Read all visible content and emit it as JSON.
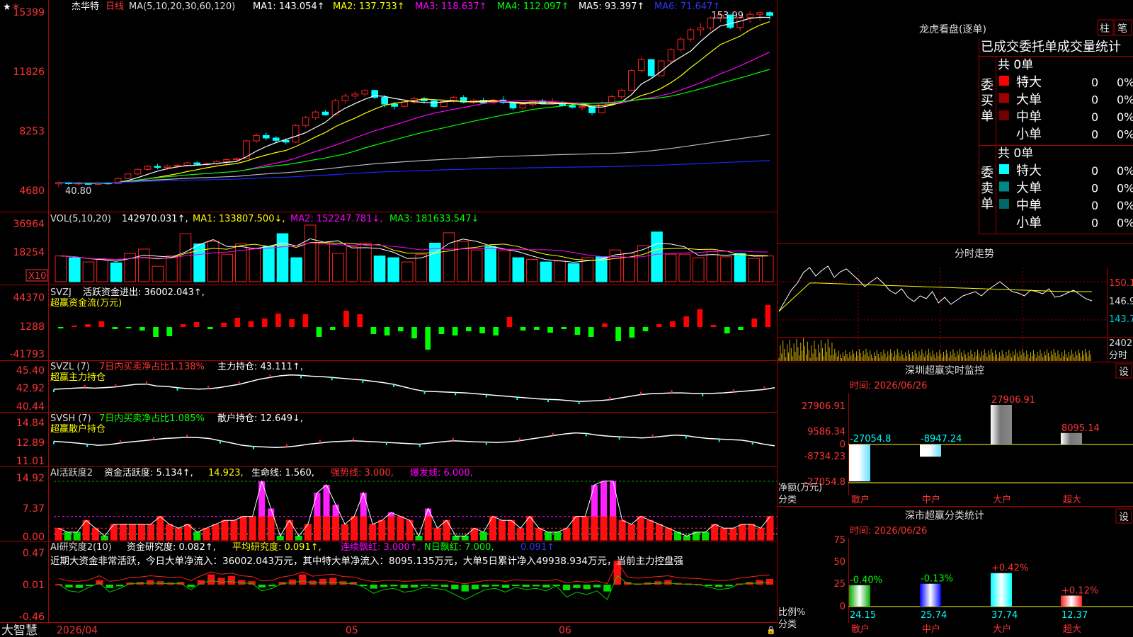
{
  "colors": {
    "up": "#ff2020",
    "down": "#00ffff",
    "grid": "#aa0000",
    "text": "#dddddd",
    "ma1": "#ffffff",
    "ma2": "#ffff00",
    "ma3": "#ff00ff",
    "ma4": "#00ff00",
    "ma5": "#bbbbbb",
    "ma6": "#2222ff",
    "label_white": "#ffffff",
    "label_yellow": "#ffff00",
    "label_magenta": "#ff00ff",
    "label_green": "#00ff00",
    "label_blue": "#3333ff",
    "label_red": "#ff3333"
  },
  "main_chart": {
    "stock_name": "杰华特",
    "period": "日线",
    "ma_header": "MA(5,10,20,30,60,120)",
    "ma1": "MA1: 143.054↑",
    "ma2": "MA2: 137.733↑",
    "ma3": "MA3: 118.637↑",
    "ma4": "MA4: 112.097↑",
    "ma5": "MA5: 93.397↑",
    "ma6": "MA6: 71.647↑",
    "y_ticks": [
      "15399",
      "11826",
      "8253",
      "4680"
    ],
    "high_label": "153.99",
    "low_label": "40.80"
  },
  "vol_panel": {
    "header": "VOL(5,10,20)",
    "value": "142970.031↑,",
    "ma1": "MA1: 133807.500↓,",
    "ma2": "MA2: 152247.781↓,",
    "ma3": "MA3: 181633.547↓",
    "y_ticks": [
      "36964",
      "18254"
    ],
    "unit": "X10"
  },
  "svzj_panel": {
    "name": "SVZJ",
    "label": "活跃资金进出: 36002.043↑,",
    "subtitle": "超赢资金流(万元)",
    "y_ticks": [
      "44370",
      "1288",
      "-41793"
    ]
  },
  "svzl_panel": {
    "name": "SVZL (7)",
    "ratio": "7日内买卖净占比1.138%",
    "hold": "主力持仓: 43.111↑,",
    "subtitle": "超赢主力持仓",
    "y_ticks": [
      "45.40",
      "42.92",
      "40.44"
    ]
  },
  "svsh_panel": {
    "name": "SVSH (7)",
    "ratio": "7日内买卖净占比1.085%",
    "hold": "散户持仓: 12.649↓,",
    "subtitle": "超赢散户持仓",
    "y_ticks": [
      "14.84",
      "12.89",
      "11.01"
    ]
  },
  "ai_active_panel": {
    "name": "AI活跃度2",
    "activity": "资金活跃度: 5.134↑,",
    "v2": "14.923,",
    "life": "生命线: 1.560,",
    "strong": "强势线: 3.000,",
    "burst": "爆发线: 6.000,",
    "y_ticks": [
      "14.92",
      "7.37",
      "0.00"
    ]
  },
  "ai_research_panel": {
    "name": "AI研究度2(10)",
    "research": "资金研究度: 0.082↑,",
    "avg": "平均研究度: 0.091↑,",
    "consec": "连续飘红: 3.000↑,",
    "nday": "N日飘红: 7.000,",
    "v5": "0.091↑",
    "comment": "近期大资金非常活跃，今日大单净流入：36002.043万元，其中特大单净流入：8095.135万元，大单5日累计净入49938.934万元，当前主力控盘强",
    "y_ticks": [
      "0.47",
      "0.01",
      "-0.46"
    ]
  },
  "x_axis": {
    "brand": "大智慧",
    "dates": [
      "2026/04",
      "05",
      "06"
    ]
  },
  "longhu": {
    "title": "龙虎看盘(逐单)",
    "btn_bar": "柱",
    "btn_pen": "笔",
    "tabs": [
      "已成交",
      "委托单",
      "成交量统计"
    ],
    "buy_label": [
      "委",
      "买",
      "单"
    ],
    "sell_label": [
      "委",
      "卖",
      "单"
    ],
    "buy_total": "共 0单",
    "sell_total": "共 0单",
    "buy_rows": [
      {
        "name": "特大",
        "count": "0",
        "pct": "0%",
        "color": "#ff0000"
      },
      {
        "name": "大单",
        "count": "0",
        "pct": "0%",
        "color": "#a00000"
      },
      {
        "name": "中单",
        "count": "0",
        "pct": "0%",
        "color": "#700000"
      },
      {
        "name": "小单",
        "count": "0",
        "pct": "0%",
        "color": ""
      }
    ],
    "sell_rows": [
      {
        "name": "特大",
        "count": "0",
        "pct": "0%",
        "color": "#00ffff"
      },
      {
        "name": "大单",
        "count": "0",
        "pct": "0%",
        "color": "#008888"
      },
      {
        "name": "中单",
        "count": "0",
        "pct": "0%",
        "color": "#006666"
      },
      {
        "name": "小单",
        "count": "0",
        "pct": "0%",
        "color": ""
      }
    ]
  },
  "intraday": {
    "title": "分时走势",
    "y_ticks": [
      "150.1",
      "146.9",
      "143.7"
    ],
    "vol_tick": "2402",
    "vol_label": "分时"
  },
  "sz_monitor": {
    "title": "深圳超赢实时监控",
    "btn": "设",
    "time": "时间: 2026/06/26",
    "y_ticks": [
      "27906.91",
      "9586.34",
      "0",
      "-8734.23",
      "-27054.8"
    ],
    "ylabel": "净额(万元)",
    "xlabel": "分类",
    "categories": [
      "散户",
      "中户",
      "大户",
      "超大"
    ],
    "values": [
      -27054.8,
      -8947.24,
      27906.91,
      8095.14
    ],
    "value_labels": [
      "-27054.8",
      "-8947.24",
      "27906.91",
      "8095.14"
    ]
  },
  "sz_classify": {
    "title": "深市超赢分类统计",
    "btn": "设",
    "time": "时间: 2026/06/26",
    "y_ticks": [
      "75",
      "50",
      "25",
      "0"
    ],
    "ylabel": "比例%",
    "xlabel": "分类",
    "categories": [
      "散户",
      "中户",
      "大户",
      "超大"
    ],
    "values": [
      24.15,
      25.74,
      37.74,
      12.37
    ],
    "value_labels": [
      "24.15",
      "25.74",
      "37.74",
      "12.37"
    ],
    "changes": [
      "-0.40%",
      "-0.13%",
      "+0.42%",
      "+0.12%"
    ]
  },
  "chart_data": {
    "type": "candlestick",
    "ylim": [
      40.8,
      153.99
    ],
    "candles": [
      [
        44.5,
        46.2,
        42.5,
        45.4
      ],
      [
        45.4,
        45.8,
        43.9,
        44.6
      ],
      [
        44.6,
        46.0,
        43.5,
        45.1
      ],
      [
        45.1,
        45.5,
        43.8,
        44.2
      ],
      [
        44.2,
        45.9,
        43.6,
        45.2
      ],
      [
        45.2,
        45.6,
        44.0,
        44.8
      ],
      [
        44.8,
        48.3,
        44.5,
        47.9
      ],
      [
        47.9,
        51.1,
        47.6,
        50.8
      ],
      [
        50.8,
        54.2,
        50.1,
        53.7
      ],
      [
        53.7,
        56.2,
        52.8,
        55.6
      ],
      [
        55.6,
        57.3,
        53.8,
        54.9
      ],
      [
        54.9,
        56.7,
        53.4,
        55.8
      ],
      [
        55.8,
        57.1,
        54.6,
        56.3
      ],
      [
        56.3,
        58.4,
        55.5,
        57.8
      ],
      [
        57.8,
        58.9,
        56.2,
        56.9
      ],
      [
        56.9,
        58.2,
        55.7,
        57.4
      ],
      [
        57.4,
        59.6,
        56.5,
        58.7
      ],
      [
        58.7,
        60.7,
        57.2,
        59.9
      ],
      [
        59.9,
        61.3,
        58.5,
        60.6
      ],
      [
        60.6,
        72.5,
        60.2,
        71.8
      ],
      [
        71.8,
        76.8,
        70.4,
        75.2
      ],
      [
        75.2,
        77.0,
        72.1,
        73.6
      ],
      [
        73.6,
        74.8,
        70.2,
        72.1
      ],
      [
        72.1,
        73.4,
        69.6,
        71.0
      ],
      [
        71.0,
        82.4,
        70.5,
        81.6
      ],
      [
        81.6,
        87.6,
        80.4,
        86.5
      ],
      [
        86.5,
        91.0,
        85.2,
        90.1
      ],
      [
        90.1,
        91.4,
        87.8,
        88.3
      ],
      [
        88.3,
        98.4,
        87.9,
        97.3
      ],
      [
        97.3,
        101.9,
        95.4,
        100.2
      ],
      [
        100.2,
        103.2,
        98.1,
        101.5
      ],
      [
        101.5,
        104.6,
        99.8,
        103.8
      ],
      [
        103.8,
        104.3,
        98.2,
        99.4
      ],
      [
        99.4,
        100.8,
        93.2,
        95.1
      ],
      [
        95.1,
        96.5,
        91.8,
        93.7
      ],
      [
        93.7,
        97.3,
        93.1,
        96.4
      ],
      [
        96.4,
        99.9,
        95.2,
        98.6
      ],
      [
        98.6,
        99.6,
        95.5,
        97.2
      ],
      [
        97.2,
        98.3,
        92.7,
        93.6
      ],
      [
        93.6,
        97.6,
        93.2,
        96.8
      ],
      [
        96.8,
        100.5,
        95.6,
        99.3
      ],
      [
        99.3,
        100.8,
        95.6,
        96.4
      ],
      [
        96.4,
        98.6,
        95.1,
        97.5
      ],
      [
        97.5,
        99.1,
        95.2,
        95.9
      ],
      [
        95.9,
        98.2,
        95.3,
        97.7
      ],
      [
        97.7,
        100.0,
        95.3,
        96.2
      ],
      [
        96.2,
        97.0,
        91.2,
        92.6
      ],
      [
        92.6,
        95.6,
        91.3,
        94.8
      ],
      [
        94.8,
        97.9,
        93.2,
        97.2
      ],
      [
        97.2,
        98.3,
        94.9,
        95.4
      ],
      [
        95.4,
        98.8,
        94.9,
        96.3
      ],
      [
        96.3,
        96.9,
        93.7,
        94.1
      ],
      [
        94.1,
        95.8,
        92.3,
        93.2
      ],
      [
        93.2,
        94.8,
        91.2,
        93.5
      ],
      [
        93.5,
        90.8,
        88.2,
        89.6
      ],
      [
        89.6,
        96.8,
        89.2,
        95.8
      ],
      [
        95.8,
        100.9,
        95.2,
        99.8
      ],
      [
        99.8,
        104.9,
        98.3,
        103.9
      ],
      [
        103.9,
        117.2,
        103.2,
        116.4
      ],
      [
        116.4,
        124.7,
        115.1,
        123.4
      ],
      [
        123.4,
        120.7,
        111.9,
        113.1
      ],
      [
        113.1,
        123.4,
        112.8,
        122.5
      ],
      [
        122.5,
        130.8,
        121.5,
        129.6
      ],
      [
        129.6,
        137.6,
        128.5,
        136.4
      ],
      [
        136.4,
        143.6,
        134.5,
        142.3
      ],
      [
        142.3,
        146.6,
        138.4,
        143.5
      ],
      [
        143.5,
        150.7,
        141.6,
        149.6
      ],
      [
        149.6,
        152.8,
        147.2,
        151.7
      ],
      [
        151.7,
        149.0,
        142.7,
        143.8
      ],
      [
        143.8,
        151.1,
        141.5,
        150.2
      ],
      [
        150.2,
        153.99,
        146.8,
        152.1
      ],
      [
        152.1,
        153.7,
        148.2,
        153.2
      ],
      [
        153.2,
        154.0,
        148.7,
        151.3
      ]
    ],
    "vol": [
      30,
      16,
      28,
      15,
      23,
      33,
      26,
      15,
      22,
      16,
      33,
      25,
      38,
      23,
      18,
      28,
      30,
      33,
      56,
      30,
      44,
      59,
      47,
      28,
      32,
      30,
      44,
      39,
      39,
      21,
      41,
      52,
      56,
      36,
      28,
      45,
      66,
      57,
      44,
      28,
      33,
      29,
      41,
      37,
      45,
      32,
      30,
      22,
      28,
      27,
      23,
      26,
      32,
      36,
      45,
      38,
      57,
      42,
      47,
      41,
      37,
      51,
      41,
      39,
      36,
      30,
      28,
      32,
      26,
      24,
      23,
      28,
      24,
      27,
      21,
      23,
      28,
      26,
      29,
      31,
      37,
      36,
      33,
      35,
      42,
      57,
      58,
      29,
      32,
      28,
      32,
      30,
      28,
      36,
      35,
      29,
      29,
      34,
      33,
      25,
      27,
      33,
      30
    ],
    "svzj": [
      -2,
      2,
      4,
      8,
      -3,
      -2,
      -5,
      -14,
      -13,
      4,
      7,
      -3,
      6,
      13,
      8,
      12,
      19,
      11,
      18,
      -14,
      -4,
      23,
      18,
      -10,
      -12,
      -6,
      -16,
      -32,
      -10,
      -12,
      -6,
      -9,
      -12,
      14,
      -5,
      -4,
      -8,
      -3,
      -11,
      -14,
      5,
      -20,
      -15,
      -6,
      4,
      8,
      15,
      25,
      3,
      -9,
      -4,
      12,
      31
    ],
    "svzl": [
      42.92,
      42.98,
      43.05,
      43.1,
      43.05,
      43.12,
      43.2,
      43.35,
      43.5,
      43.52,
      43.3,
      43.25,
      43.1,
      43.0,
      42.94,
      42.98,
      43.1,
      43.3,
      43.5,
      43.8,
      44.1,
      44.3,
      44.5,
      44.6,
      44.55,
      44.45,
      44.4,
      44.3,
      44.2,
      44.1,
      44.0,
      43.85,
      43.7,
      43.5,
      43.2,
      42.9,
      42.7,
      42.65,
      42.6,
      42.55,
      42.5,
      42.4,
      42.3,
      42.2,
      42.1,
      42.0,
      41.9,
      41.8,
      41.75,
      41.7,
      41.6,
      41.5,
      41.55,
      41.6,
      41.7,
      41.9,
      42.1,
      42.3,
      42.4,
      42.45,
      42.5,
      42.5,
      42.45,
      42.42,
      42.45,
      42.5,
      42.6,
      42.7,
      42.8,
      42.9,
      43.1
    ],
    "svsh": [
      13.05,
      12.98,
      12.9,
      12.8,
      12.7,
      12.75,
      12.9,
      13.0,
      13.1,
      13.2,
      13.3,
      13.35,
      13.4,
      13.38,
      13.3,
      13.1,
      12.9,
      12.7,
      12.6,
      12.55,
      12.5,
      12.55,
      12.65,
      12.8,
      12.9,
      13.0,
      13.05,
      13.1,
      13.05,
      13.0,
      12.95,
      12.9,
      12.85,
      12.8,
      12.9,
      13.0,
      13.1,
      13.05,
      13.0,
      12.98,
      12.95,
      13.0,
      13.1,
      13.25,
      13.4,
      13.55,
      13.7,
      13.8,
      13.75,
      13.6,
      13.5,
      13.45,
      13.4,
      13.35,
      13.4,
      13.5,
      13.6,
      13.55,
      13.4,
      13.3,
      13.25,
      13.2,
      13.15,
      13.0,
      12.8,
      12.65
    ],
    "ai_active": [
      3,
      2,
      2,
      5,
      3,
      1,
      4,
      4,
      4,
      4,
      4,
      6,
      4,
      3,
      4,
      2,
      3,
      4,
      5,
      5,
      6,
      6,
      14.9,
      8,
      1,
      5,
      1,
      4,
      12,
      14,
      9,
      4,
      6,
      12,
      4,
      5,
      7,
      6,
      5,
      1,
      8,
      3,
      5,
      1,
      1,
      3,
      2,
      6,
      5,
      5,
      3,
      6,
      3,
      2,
      2,
      3,
      6,
      6,
      14,
      15,
      15,
      5,
      4,
      6,
      5,
      4,
      3,
      2,
      1,
      2,
      2,
      4,
      3,
      3,
      4,
      4,
      3,
      6
    ],
    "ai_research": [
      0.01,
      -0.05,
      -0.06,
      -0.02,
      0.08,
      -0.06,
      -0.03,
      0.04,
      0.05,
      0.08,
      0.06,
      0.04,
      0.05,
      -0.04,
      0.08,
      0.18,
      0.12,
      0.15,
      0.08,
      0.06,
      -0.05,
      -0.03,
      0.05,
      0.09,
      0.18,
      0.07,
      0.1,
      0.12,
      0.06,
      0.05,
      -0.02,
      -0.07,
      -0.04,
      -0.03,
      -0.06,
      -0.05,
      -0.02,
      -0.03,
      -0.04,
      -0.08,
      -0.12,
      -0.08,
      -0.04,
      -0.03,
      -0.06,
      -0.02,
      -0.04,
      -0.03,
      -0.05,
      -0.01,
      -0.1,
      -0.06,
      -0.08,
      -0.05,
      -0.12,
      0.42,
      0.05,
      0.02,
      0.04,
      0.06,
      0.08,
      0.03,
      0.02,
      0.01,
      -0.02,
      -0.04,
      -0.03,
      0.02,
      0.05,
      0.08,
      0.1
    ]
  }
}
